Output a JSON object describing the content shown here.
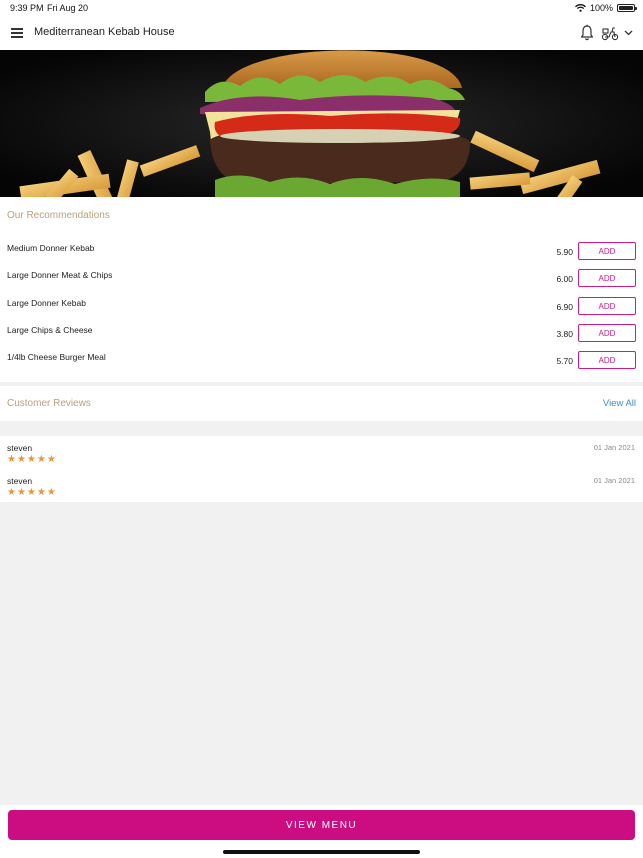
{
  "status": {
    "time": "9:39 PM",
    "date": "Fri Aug 20",
    "battery_text": "100%",
    "battery_level": 1.0
  },
  "header": {
    "title": "Mediterranean Kebab House",
    "icons": [
      "menu-icon",
      "bell-icon",
      "scooter-icon",
      "chevron-down-icon"
    ]
  },
  "hero": {
    "image": "burger-with-fries"
  },
  "recommendations": {
    "title": "Our Recommendations",
    "add_label": "ADD",
    "items": [
      {
        "name": "Medium Donner Kebab",
        "price": "5.90"
      },
      {
        "name": "Large Donner Meat & Chips",
        "price": "6.00"
      },
      {
        "name": "Large Donner Kebab",
        "price": "6.90"
      },
      {
        "name": "Large Chips & Cheese",
        "price": "3.80"
      },
      {
        "name": "1/4lb Cheese Burger Meal",
        "price": "5.70"
      }
    ]
  },
  "reviews": {
    "title": "Customer Reviews",
    "view_all": "View All",
    "items": [
      {
        "name": "steven",
        "date": "01 Jan 2021",
        "stars": "★★★★★",
        "rating": 5
      },
      {
        "name": "steven",
        "date": "01 Jan 2021",
        "stars": "★★★★★",
        "rating": 5
      }
    ]
  },
  "footer": {
    "view_menu": "VIEW MENU"
  },
  "colors": {
    "accent": "#cc0d82",
    "section_title": "#b8a07e",
    "link": "#3a8ec2",
    "star": "#e8963a"
  }
}
